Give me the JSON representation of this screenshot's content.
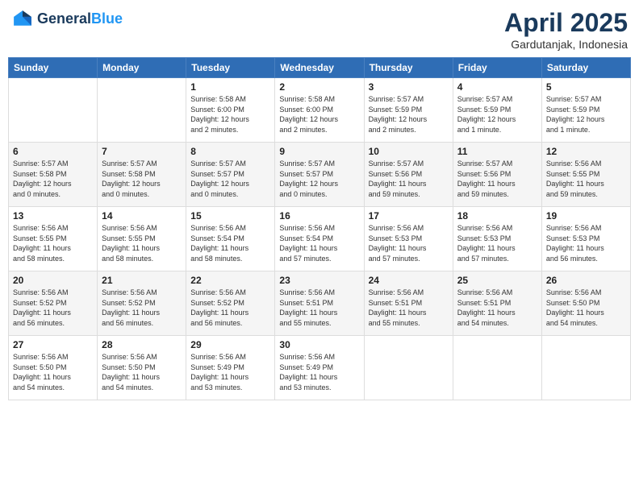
{
  "logo": {
    "line1": "General",
    "line2": "Blue"
  },
  "title": "April 2025",
  "location": "Gardutanjak, Indonesia",
  "weekdays": [
    "Sunday",
    "Monday",
    "Tuesday",
    "Wednesday",
    "Thursday",
    "Friday",
    "Saturday"
  ],
  "weeks": [
    [
      {
        "day": "",
        "info": ""
      },
      {
        "day": "",
        "info": ""
      },
      {
        "day": "1",
        "info": "Sunrise: 5:58 AM\nSunset: 6:00 PM\nDaylight: 12 hours\nand 2 minutes."
      },
      {
        "day": "2",
        "info": "Sunrise: 5:58 AM\nSunset: 6:00 PM\nDaylight: 12 hours\nand 2 minutes."
      },
      {
        "day": "3",
        "info": "Sunrise: 5:57 AM\nSunset: 5:59 PM\nDaylight: 12 hours\nand 2 minutes."
      },
      {
        "day": "4",
        "info": "Sunrise: 5:57 AM\nSunset: 5:59 PM\nDaylight: 12 hours\nand 1 minute."
      },
      {
        "day": "5",
        "info": "Sunrise: 5:57 AM\nSunset: 5:59 PM\nDaylight: 12 hours\nand 1 minute."
      }
    ],
    [
      {
        "day": "6",
        "info": "Sunrise: 5:57 AM\nSunset: 5:58 PM\nDaylight: 12 hours\nand 0 minutes."
      },
      {
        "day": "7",
        "info": "Sunrise: 5:57 AM\nSunset: 5:58 PM\nDaylight: 12 hours\nand 0 minutes."
      },
      {
        "day": "8",
        "info": "Sunrise: 5:57 AM\nSunset: 5:57 PM\nDaylight: 12 hours\nand 0 minutes."
      },
      {
        "day": "9",
        "info": "Sunrise: 5:57 AM\nSunset: 5:57 PM\nDaylight: 12 hours\nand 0 minutes."
      },
      {
        "day": "10",
        "info": "Sunrise: 5:57 AM\nSunset: 5:56 PM\nDaylight: 11 hours\nand 59 minutes."
      },
      {
        "day": "11",
        "info": "Sunrise: 5:57 AM\nSunset: 5:56 PM\nDaylight: 11 hours\nand 59 minutes."
      },
      {
        "day": "12",
        "info": "Sunrise: 5:56 AM\nSunset: 5:55 PM\nDaylight: 11 hours\nand 59 minutes."
      }
    ],
    [
      {
        "day": "13",
        "info": "Sunrise: 5:56 AM\nSunset: 5:55 PM\nDaylight: 11 hours\nand 58 minutes."
      },
      {
        "day": "14",
        "info": "Sunrise: 5:56 AM\nSunset: 5:55 PM\nDaylight: 11 hours\nand 58 minutes."
      },
      {
        "day": "15",
        "info": "Sunrise: 5:56 AM\nSunset: 5:54 PM\nDaylight: 11 hours\nand 58 minutes."
      },
      {
        "day": "16",
        "info": "Sunrise: 5:56 AM\nSunset: 5:54 PM\nDaylight: 11 hours\nand 57 minutes."
      },
      {
        "day": "17",
        "info": "Sunrise: 5:56 AM\nSunset: 5:53 PM\nDaylight: 11 hours\nand 57 minutes."
      },
      {
        "day": "18",
        "info": "Sunrise: 5:56 AM\nSunset: 5:53 PM\nDaylight: 11 hours\nand 57 minutes."
      },
      {
        "day": "19",
        "info": "Sunrise: 5:56 AM\nSunset: 5:53 PM\nDaylight: 11 hours\nand 56 minutes."
      }
    ],
    [
      {
        "day": "20",
        "info": "Sunrise: 5:56 AM\nSunset: 5:52 PM\nDaylight: 11 hours\nand 56 minutes."
      },
      {
        "day": "21",
        "info": "Sunrise: 5:56 AM\nSunset: 5:52 PM\nDaylight: 11 hours\nand 56 minutes."
      },
      {
        "day": "22",
        "info": "Sunrise: 5:56 AM\nSunset: 5:52 PM\nDaylight: 11 hours\nand 56 minutes."
      },
      {
        "day": "23",
        "info": "Sunrise: 5:56 AM\nSunset: 5:51 PM\nDaylight: 11 hours\nand 55 minutes."
      },
      {
        "day": "24",
        "info": "Sunrise: 5:56 AM\nSunset: 5:51 PM\nDaylight: 11 hours\nand 55 minutes."
      },
      {
        "day": "25",
        "info": "Sunrise: 5:56 AM\nSunset: 5:51 PM\nDaylight: 11 hours\nand 54 minutes."
      },
      {
        "day": "26",
        "info": "Sunrise: 5:56 AM\nSunset: 5:50 PM\nDaylight: 11 hours\nand 54 minutes."
      }
    ],
    [
      {
        "day": "27",
        "info": "Sunrise: 5:56 AM\nSunset: 5:50 PM\nDaylight: 11 hours\nand 54 minutes."
      },
      {
        "day": "28",
        "info": "Sunrise: 5:56 AM\nSunset: 5:50 PM\nDaylight: 11 hours\nand 54 minutes."
      },
      {
        "day": "29",
        "info": "Sunrise: 5:56 AM\nSunset: 5:49 PM\nDaylight: 11 hours\nand 53 minutes."
      },
      {
        "day": "30",
        "info": "Sunrise: 5:56 AM\nSunset: 5:49 PM\nDaylight: 11 hours\nand 53 minutes."
      },
      {
        "day": "",
        "info": ""
      },
      {
        "day": "",
        "info": ""
      },
      {
        "day": "",
        "info": ""
      }
    ]
  ]
}
